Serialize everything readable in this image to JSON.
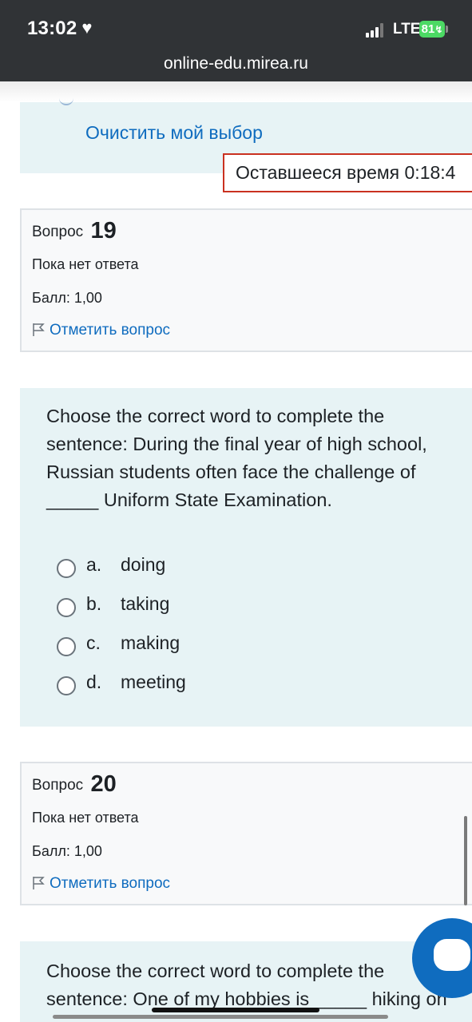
{
  "status_bar": {
    "time": "13:02",
    "network": "LTE",
    "battery": "81"
  },
  "browser": {
    "url": "online-edu.mirea.ru"
  },
  "previous_question": {
    "clear_choice_label": "Очистить мой выбор"
  },
  "timer": {
    "text": "Оставшееся время 0:18:4"
  },
  "q19_info": {
    "prefix": "Вопрос",
    "number": "19",
    "state": "Пока нет ответа",
    "grade": "Балл: 1,00",
    "flag_label": "Отметить вопрос"
  },
  "q19": {
    "text": "Choose the correct word to complete the sentence: During the final year of high school, Russian students often face the challenge of _____ Uniform State Examination.",
    "answers": [
      {
        "letter": "a.",
        "word": "doing"
      },
      {
        "letter": "b.",
        "word": "taking"
      },
      {
        "letter": "c.",
        "word": "making"
      },
      {
        "letter": "d.",
        "word": "meeting"
      }
    ]
  },
  "q20_info": {
    "prefix": "Вопрос",
    "number": "20",
    "state": "Пока нет ответа",
    "grade": "Балл: 1,00",
    "flag_label": "Отметить вопрос"
  },
  "q20": {
    "line1": "Choose the correct word to complete the",
    "line2": "sentence: One of my hobbies is _____ hiking on"
  },
  "colors": {
    "link": "#0f6cbf",
    "timer_border": "#ca3120",
    "question_bg": "#e7f3f5",
    "info_bg": "#f8f9fa"
  },
  "icons": [
    "heart-icon",
    "signal-icon",
    "battery-icon",
    "flag-icon",
    "chat-icon"
  ]
}
